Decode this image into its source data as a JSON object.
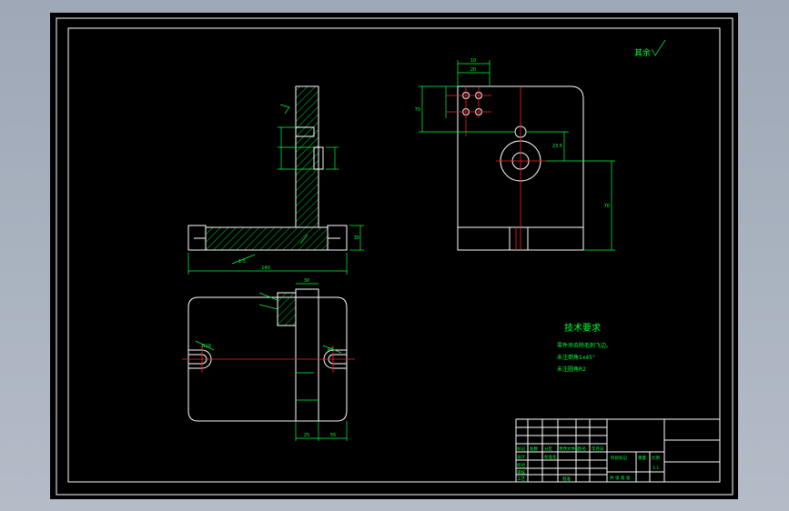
{
  "drawing": {
    "roughness_note": "其余",
    "tech_req": {
      "title": "技术要求",
      "lines": [
        "零件须去除毛刺飞边。",
        "未注倒角1x45°",
        "未注圆角R2"
      ]
    },
    "dims": {
      "front_width": "140",
      "front_height": "30",
      "slope_left": "1:5",
      "top_view_a": "30",
      "top_view_b": "25",
      "top_view_c": "55",
      "r10": "R10",
      "r5": "R5",
      "side_w": "70",
      "side_h": "70",
      "side_pos": "23.5",
      "side_hole_a": "10",
      "side_hole_b": "20"
    },
    "title_block": {
      "rows": [
        "标记",
        "处数",
        "分区",
        "更改文件号",
        "签名",
        "年月日"
      ],
      "labels": [
        "设计",
        "校对",
        "审核",
        "工艺",
        "标准化",
        "批准"
      ],
      "stage": "阶段标记",
      "weight": "重量",
      "scale": "比例",
      "scale_val": "1:1",
      "sheet": "共 张 第 张"
    }
  },
  "colors": {
    "outline": "#ffffff",
    "dimension": "#00ff3c",
    "centerline": "#ff2020",
    "background": "#000000"
  }
}
